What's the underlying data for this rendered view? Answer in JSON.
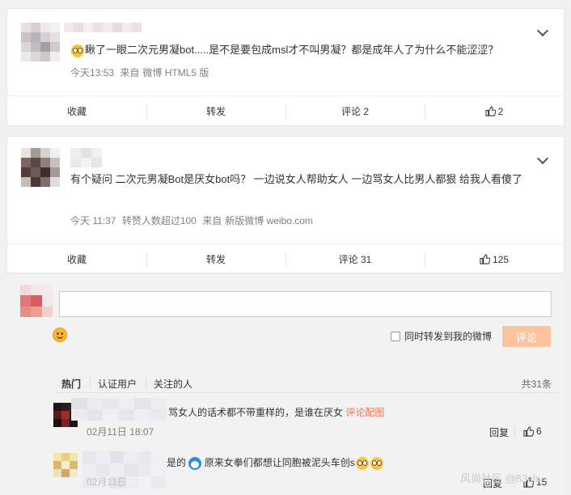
{
  "colors": {
    "accent": "#eb7350",
    "submit_bg": "#fcc49e",
    "meta": "#808080"
  },
  "posts": [
    {
      "text": "瞅了一眼二次元男凝bot.....是不是要包成msl才不叫男凝？都是成年人了为什么不能涩涩？",
      "leading_emoji": "smile-emoji",
      "meta": {
        "time": "今天13:53",
        "source_prefix": "来自",
        "source": "微博 HTML5 版"
      },
      "actions": {
        "favorite": "收藏",
        "repost": "转发",
        "comment": "评论 2",
        "likes": "2"
      }
    },
    {
      "text": "有个疑问 二次元男凝Bot是厌女bot吗？ 一边说女人帮助女人 一边骂女人比男人都狠 给我人看傻了",
      "meta": {
        "time": "今天 11:37",
        "repost_info": "转赞人数超过100",
        "source_prefix": "来自",
        "source": "新版微博 weibo.com"
      },
      "actions": {
        "favorite": "收藏",
        "repost": "转发",
        "comment": "评论 31",
        "likes": "125"
      }
    }
  ],
  "composer": {
    "input_value": "",
    "emoji_icon": "smile-icon",
    "also_repost_label": "同时转发到我的微博",
    "submit_label": "评论"
  },
  "comment_tabs": {
    "hot": "热门",
    "verified": "认证用户",
    "following": "关注的人",
    "total": "共31条"
  },
  "comments": [
    {
      "text": "骂女人的话术都不带重样的，是谁在厌女",
      "link": "评论配图",
      "time": "02月11日 18:07",
      "reply": "回复",
      "likes": "6"
    },
    {
      "text_a": "是的",
      "text_b": "原来女拳们都想让同胞被泥头车创s",
      "time": "02月11日",
      "reply": "回复",
      "likes": "15"
    }
  ],
  "watermark": "风尚社区 @83cls"
}
